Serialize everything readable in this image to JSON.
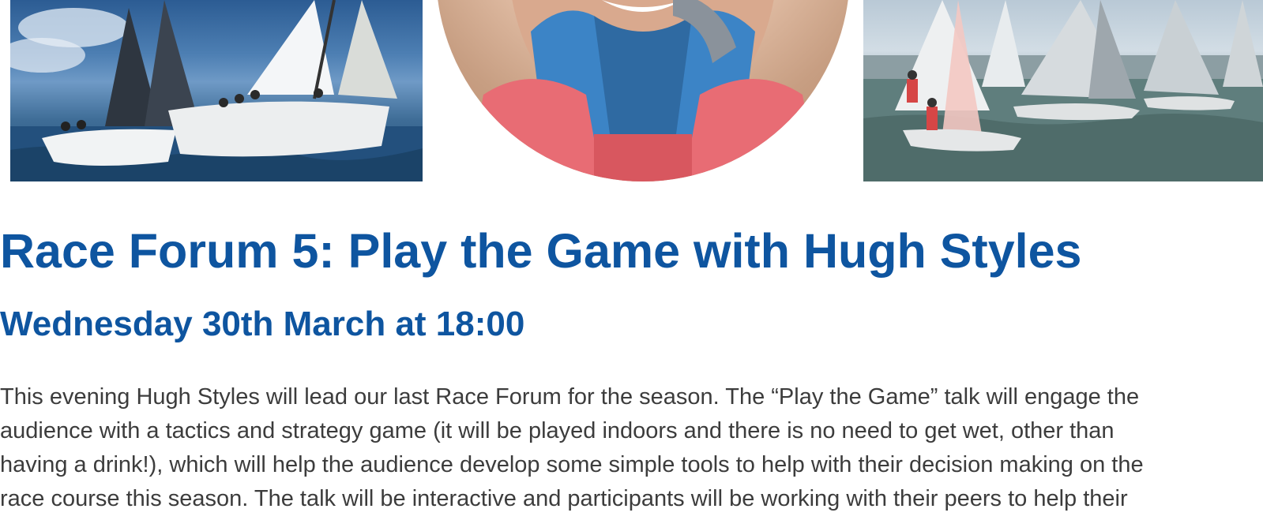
{
  "images": [
    {
      "name": "sailing-yachts-photo"
    },
    {
      "name": "hugh-styles-portrait"
    },
    {
      "name": "dinghy-racing-photo"
    }
  ],
  "event": {
    "title": "Race Forum 5: Play the Game with Hugh Styles",
    "datetime": "Wednesday 30th March at 18:00",
    "description_lines": [
      "This evening Hugh Styles will lead our last Race Forum for the season. The “Play the Game” talk will engage the",
      "audience with a tactics and strategy game (it will be played indoors and there is no need to get wet, other than",
      "having a drink!), which will help the audience develop some simple tools to help with their decision making on the",
      "race course this season. The talk will be interactive and participants will be working with their peers to help their"
    ]
  },
  "colors": {
    "heading": "#0e55a0",
    "body_text": "#3c3c3c",
    "background": "#ffffff"
  }
}
